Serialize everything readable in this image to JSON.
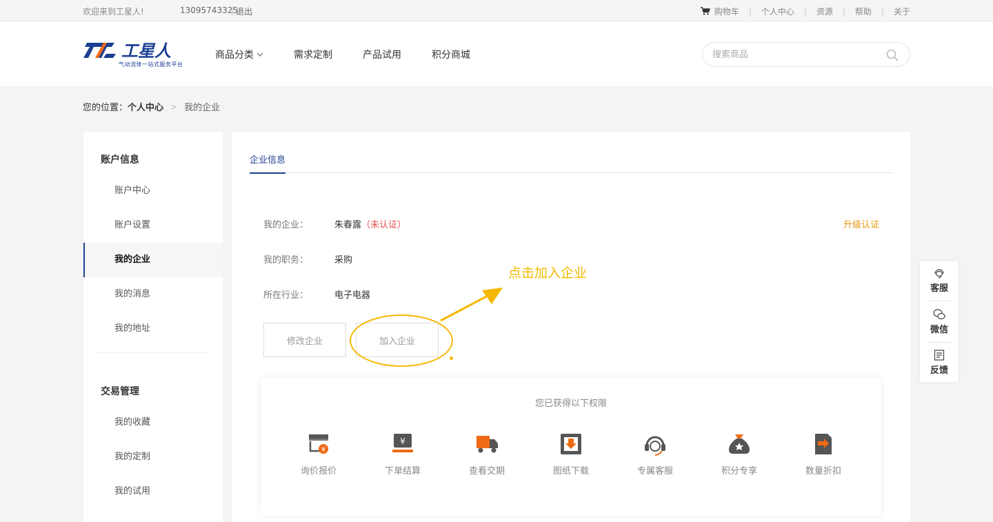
{
  "topbar": {
    "welcome": "欢迎来到工星人!",
    "phone": "13095743325",
    "separator": "|",
    "logout": "退出",
    "links": [
      "购物车",
      "个人中心",
      "资源",
      "帮助",
      "关于"
    ]
  },
  "header": {
    "logo_text": "工星人",
    "logo_slogan": "气动流体一站式服务平台",
    "nav": [
      "商品分类",
      "需求定制",
      "产品试用",
      "积分商城"
    ],
    "search_placeholder": "搜索商品"
  },
  "breadcrumb": {
    "prefix": "您的位置：",
    "current": "个人中心",
    "arrow": ">",
    "last": "我的企业"
  },
  "sidebar": {
    "group1_title": "账户信息",
    "group1_items": [
      "账户中心",
      "账户设置",
      "我的企业",
      "我的消息",
      "我的地址"
    ],
    "active_item": "我的企业",
    "group2_title": "交易管理",
    "group2_items": [
      "我的收藏",
      "我的定制",
      "我的试用"
    ]
  },
  "main": {
    "tab": "企业信息",
    "company_label": "我的企业：",
    "company_value": "朱春露",
    "company_status": "（未认证）",
    "upgrade": "升级认证",
    "position_label": "我的职务：",
    "position_value": "采购",
    "industry_label": "所在行业：",
    "industry_value": "电子电器",
    "edit_button": "修改企业",
    "join_button": "加入企业",
    "annotation": "点击加入企业"
  },
  "permissions": {
    "title": "您已获得以下权限",
    "items": [
      "询价报价",
      "下单结算",
      "查看交期",
      "图纸下载",
      "专属客服",
      "积分专享",
      "数量折扣"
    ]
  },
  "float_service": [
    "客服",
    "微信",
    "反馈"
  ],
  "colors": {
    "brand_blue": "#1b3f93",
    "brand_orange": "#f06a14",
    "annotation_yellow": "#f5b800",
    "upgrade_orange": "#e8960c",
    "unverified_red": "#e84e4e",
    "icon_gray": "#555555"
  }
}
